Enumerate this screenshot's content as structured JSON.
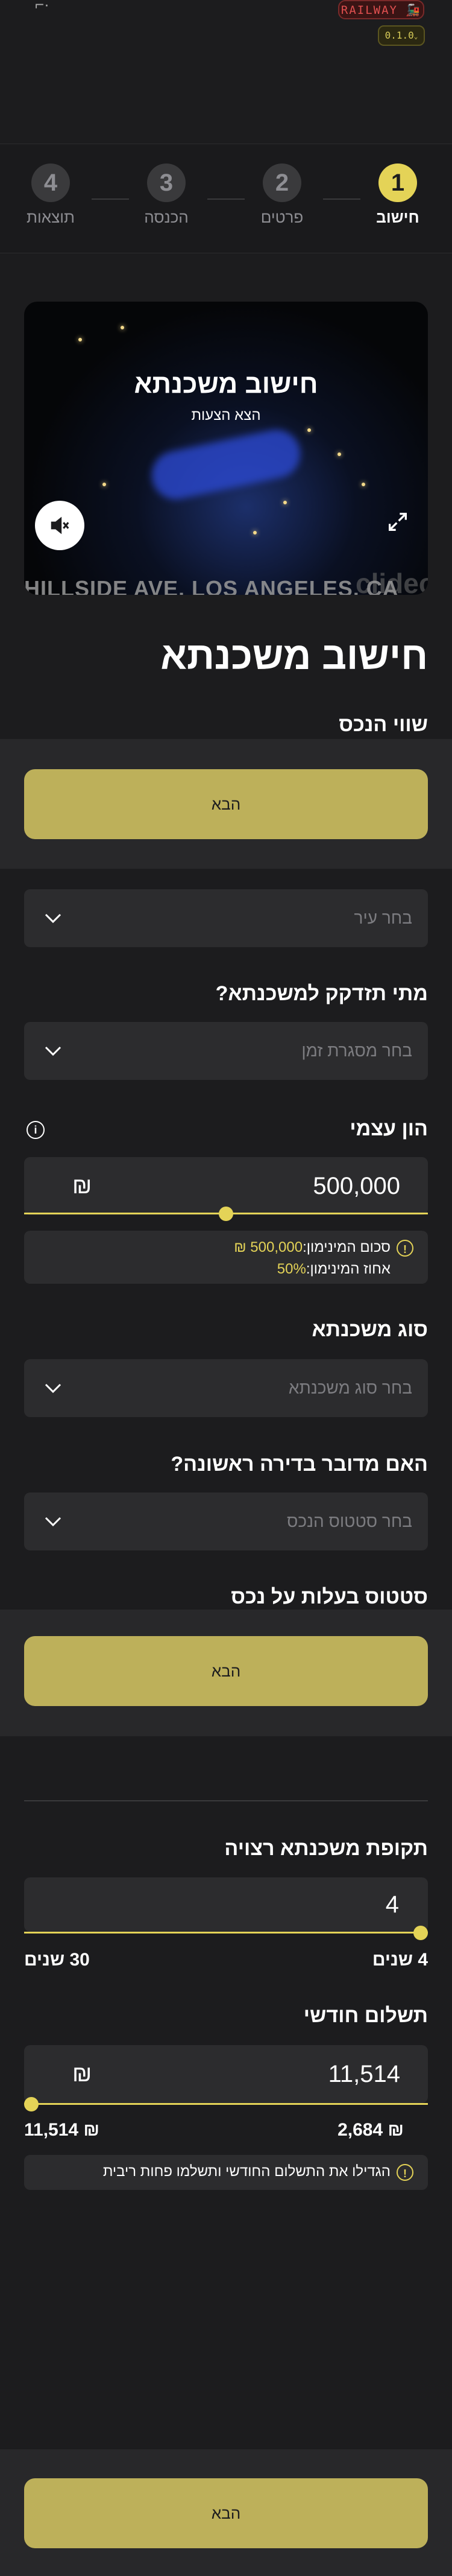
{
  "header": {
    "brand": "RAILWAY 🚂",
    "version": "0.1.0",
    "corner_glyph": "⌐·"
  },
  "stepper": {
    "steps": [
      {
        "number": "1",
        "label": "חישוב",
        "active": true
      },
      {
        "number": "2",
        "label": "פרטים",
        "active": false
      },
      {
        "number": "3",
        "label": "הכנסה",
        "active": false
      },
      {
        "number": "4",
        "label": "תוצאות",
        "active": false
      }
    ]
  },
  "video": {
    "title": "חישוב משכנתא",
    "subtitle": "הצא הצעות",
    "street_text": "HILLSIDE AVE, LOS ANGELES, CA",
    "watermark": "clideo",
    "mute_icon": "speaker-muted-icon",
    "expand_icon": "expand-icon"
  },
  "page_title": "חישוב משכנתא",
  "property_value_label": "שווי הנכס",
  "next_label": "הבא",
  "city": {
    "placeholder": "בחר עיר"
  },
  "timeframe": {
    "label": "מתי תזדקק למשכנתא?",
    "placeholder": "בחר מסגרת זמן"
  },
  "equity": {
    "label": "הון עצמי",
    "value": "500,000",
    "currency": "₪",
    "slider_fraction": 0.5,
    "min_sum_label": "סכום המינימון:",
    "min_sum_value": "500,000 ₪",
    "min_pct_label": "אחוז המינימון:",
    "min_pct_value": "50%"
  },
  "mortgage_type": {
    "label": "סוג משכנתא",
    "placeholder": "בחר סוג משכנתא"
  },
  "first_apartment": {
    "label": "האם מדובר בדירה ראשונה?",
    "placeholder": "בחר סטטוס הנכס"
  },
  "ownership_label": "סטטוס בעלות על נכס",
  "period": {
    "label": "תקופת משכנתא רצויה",
    "value": "4",
    "min_label": "4 שנים",
    "max_label": "30 שנים",
    "slider_fraction": 0.0
  },
  "monthly": {
    "label": "תשלום חודשי",
    "value": "11,514",
    "currency": "₪",
    "min_label": "₪ 2,684",
    "max_label": "₪ 11,514",
    "slider_fraction": 1.0,
    "tip": "הגדילו את התשלום החודשי ותשלמו פחות ריבית"
  },
  "colors": {
    "accent": "#e4d357",
    "button": "#bdb05a",
    "background": "#1c1c1e",
    "field": "#2c2c2e"
  }
}
